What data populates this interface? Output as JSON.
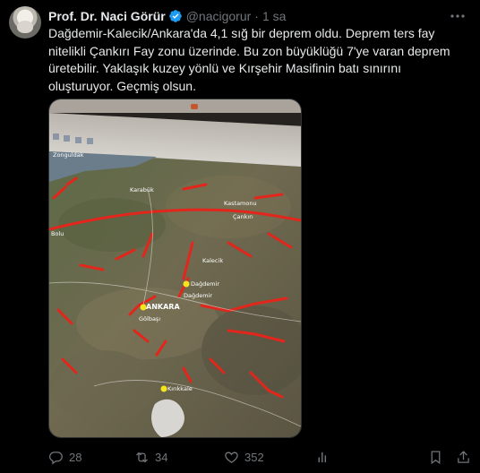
{
  "author": {
    "name": "Prof. Dr. Naci Görür",
    "handle": "@nacigorur",
    "separator": "·",
    "time": "1 sa"
  },
  "tweet": {
    "text": "Dağdemir-Kalecik/Ankara'da 4,1 sığ bir deprem oldu. Deprem ters fay nitelikli Çankırı Fay zonu üzerinde. Bu zon büyüklüğü 7'ye varan deprem üretebilir. Yaklaşık kuzey yönlü ve Kırşehir Masifinin batı sınırını oluşturuyor. Geçmiş olsun."
  },
  "map": {
    "labels": {
      "zonguldak": "Zonguldak",
      "karabuk": "Karabük",
      "kastamonu": "Kastamonu",
      "cankiri": "Çankırı",
      "bolu": "Bolu",
      "dagdemir1": "Dağdemir",
      "dagdemir2": "Dağdemir",
      "ankara": "ANKARA",
      "kirikkale": "Kırıkkale",
      "golbasi": "Gölbaşı",
      "kalecik": "Kalecik"
    }
  },
  "stats": {
    "replies": "28",
    "retweets": "34",
    "likes": "352",
    "views": ""
  },
  "icons": {
    "verified": "verified-badge-icon",
    "more": "more-options-icon",
    "reply": "reply-icon",
    "retweet": "retweet-icon",
    "like": "heart-icon",
    "views": "views-icon",
    "bookmark": "bookmark-icon",
    "share": "share-icon"
  },
  "colors": {
    "accent": "#1d9bf0",
    "text": "#e7e9ea",
    "muted": "#71767b",
    "fault": "#e2261c",
    "pin": "#f5e61b"
  }
}
